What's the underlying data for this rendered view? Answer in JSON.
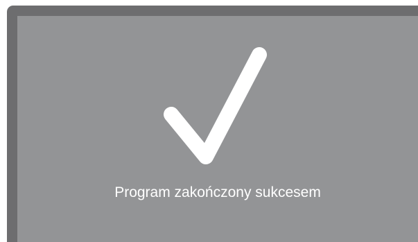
{
  "status": {
    "message": "Program zakończony sukcesem",
    "icon": "checkmark-icon"
  },
  "colors": {
    "frame": "#6d6d6f",
    "screen": "#939496",
    "icon": "#ffffff",
    "text": "#ffffff"
  }
}
